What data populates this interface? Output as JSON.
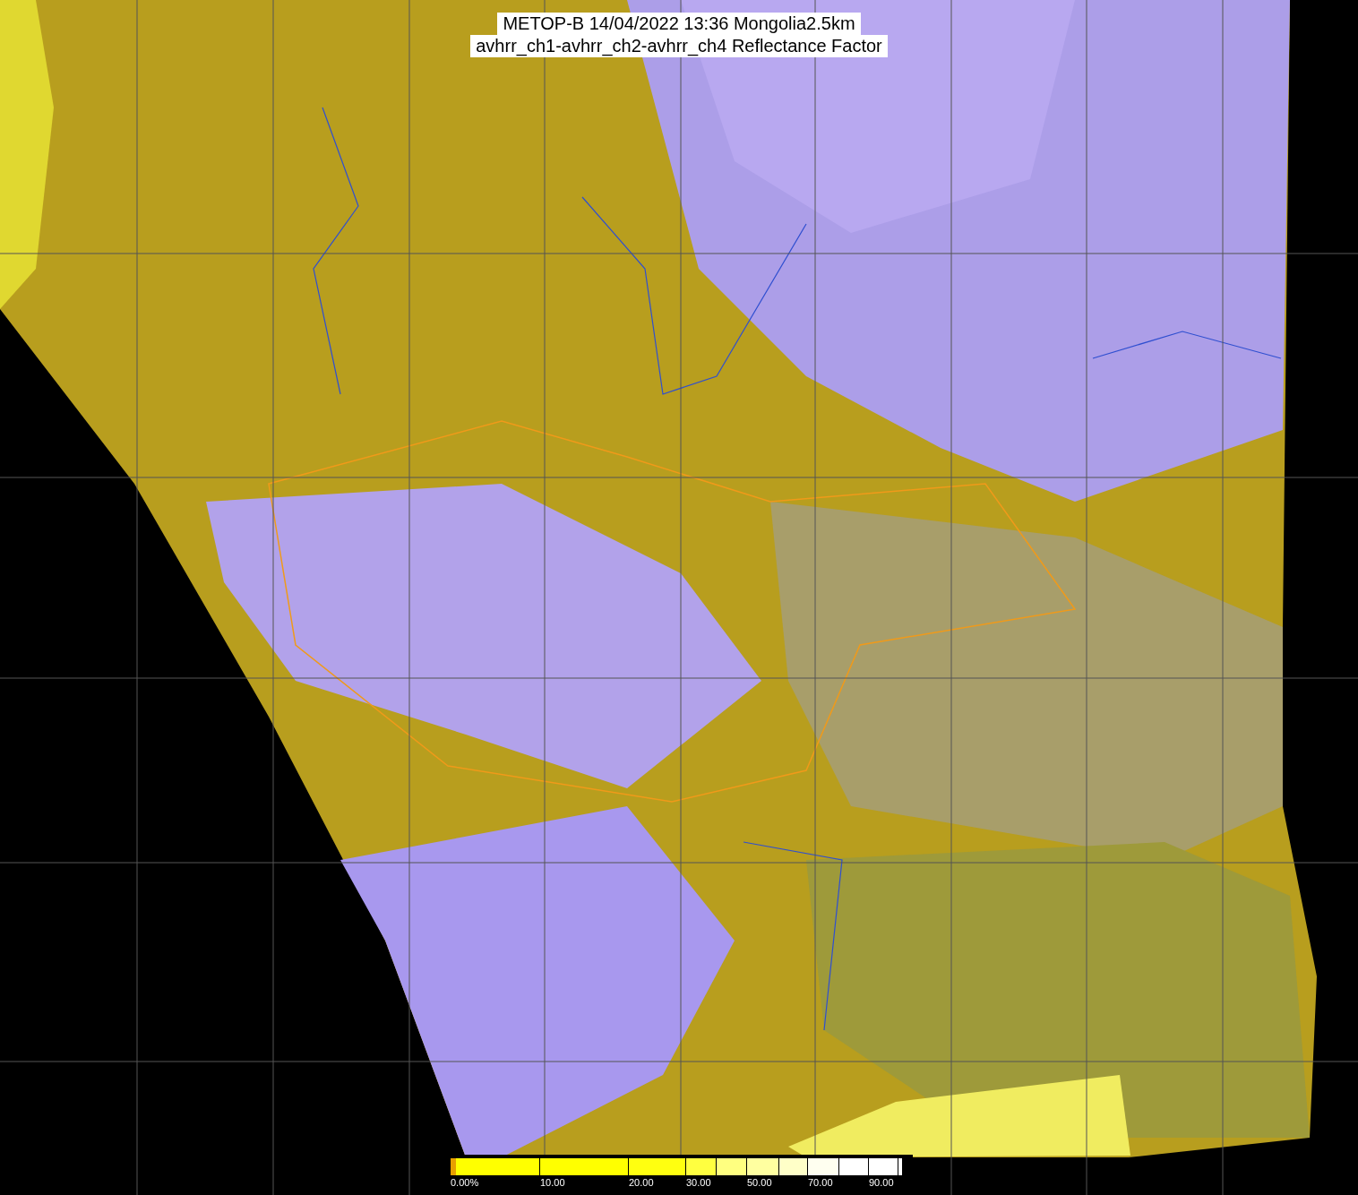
{
  "title_lines": [
    "METOP-B 14/04/2022 13:36 Mongolia2.5km",
    "avhrr_ch1-avhrr_ch2-avhrr_ch4 Reflectance Factor"
  ],
  "legend": {
    "labels": [
      "0.00%",
      "10.00",
      "20.00",
      "30.00",
      "50.00",
      "70.00",
      "90.00"
    ]
  }
}
